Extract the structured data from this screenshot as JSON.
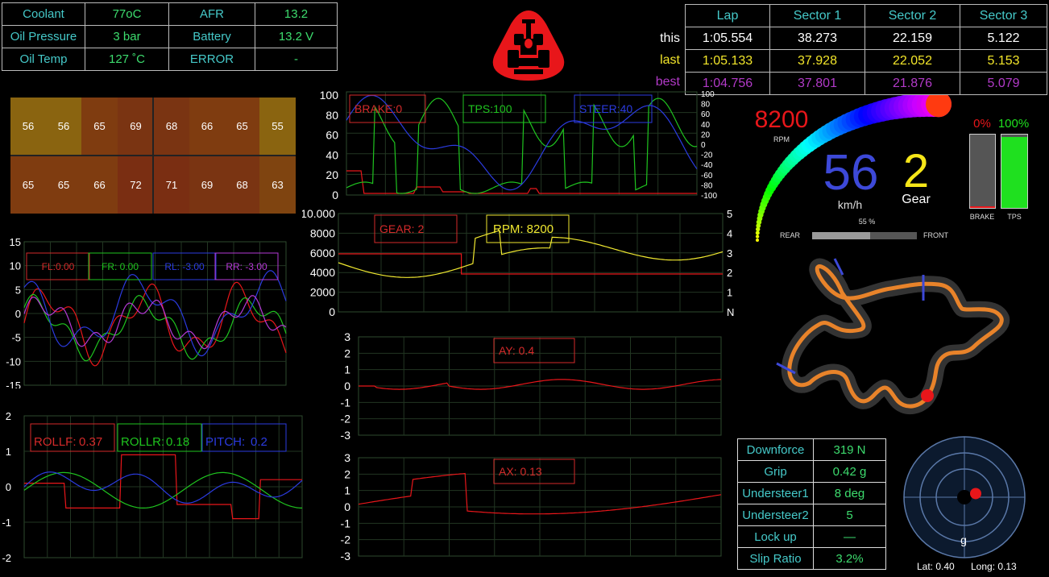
{
  "status_table": [
    {
      "k1": "Coolant",
      "v1": "77oC",
      "k2": "AFR",
      "v2": "13.2"
    },
    {
      "k1": "Oil Pressure",
      "v1": "3 bar",
      "k2": "Battery",
      "v2": "13.2 V"
    },
    {
      "k1": "Oil Temp",
      "v1": "127 ˚C",
      "k2": "ERROR",
      "v2": "-"
    }
  ],
  "lap_table": {
    "headers": [
      "Lap",
      "Sector 1",
      "Sector 2",
      "Sector 3"
    ],
    "rows": [
      {
        "name": "this",
        "color": "#ffffff",
        "values": [
          "1:05.554",
          "38.273",
          "22.159",
          "5.122"
        ]
      },
      {
        "name": "last",
        "color": "#f2e52a",
        "values": [
          "1:05.133",
          "37.928",
          "22.052",
          "5.153"
        ]
      },
      {
        "name": "best",
        "color": "#b23ac8",
        "values": [
          "1:04.756",
          "37.801",
          "21.876",
          "5.079"
        ]
      }
    ]
  },
  "tyre_temps": {
    "cells": [
      {
        "value": "56",
        "color": "#8a6410"
      },
      {
        "value": "56",
        "color": "#8a6410"
      },
      {
        "value": "65",
        "color": "#7f3c10"
      },
      {
        "value": "69",
        "color": "#7a3412"
      },
      {
        "value": "68",
        "color": "#7a3412"
      },
      {
        "value": "66",
        "color": "#7f3c10"
      },
      {
        "value": "65",
        "color": "#7f3c10"
      },
      {
        "value": "55",
        "color": "#8a6410"
      },
      {
        "value": "65",
        "color": "#7f3c10"
      },
      {
        "value": "65",
        "color": "#7f3c10"
      },
      {
        "value": "66",
        "color": "#7f3c10"
      },
      {
        "value": "72",
        "color": "#7a2e12"
      },
      {
        "value": "71",
        "color": "#7a2e12"
      },
      {
        "value": "69",
        "color": "#7a3412"
      },
      {
        "value": "68",
        "color": "#7a3412"
      },
      {
        "value": "63",
        "color": "#7f4410"
      }
    ]
  },
  "gauge": {
    "rpm_value": "8200",
    "rpm_unit": "RPM",
    "speed": "56",
    "speed_unit": "km/h",
    "gear": "2",
    "gear_label": "Gear",
    "brake_pct": "0%",
    "tps_pct": "100%",
    "brake_label": "BRAKE",
    "tps_label": "TPS",
    "brake_fill": 0.0,
    "tps_fill": 1.0,
    "balance_pct": "55 %",
    "rear_label": "REAR",
    "front_label": "FRONT",
    "balance_fill": 0.55
  },
  "stats_table": [
    {
      "k": "Downforce",
      "v": "319 N"
    },
    {
      "k": "Grip",
      "v": "0.42 g"
    },
    {
      "k": "Understeer1",
      "v": "8 deg"
    },
    {
      "k": "Understeer2",
      "v": "5"
    },
    {
      "k": "Lock up",
      "v": "—"
    },
    {
      "k": "Slip Ratio",
      "v": "3.2%"
    }
  ],
  "gg": {
    "lat_label": "Lat: 0.40",
    "long_label": "Long: 0.13",
    "unit": "g",
    "lat": 0.4,
    "long": 0.13
  },
  "charts": {
    "inputs": {
      "legend": [
        {
          "text": "BRAKE:0",
          "color": "#d42a2a"
        },
        {
          "text": "TPS:100",
          "color": "#1fc41f"
        },
        {
          "text": "STEER:40",
          "color": "#2b3be0"
        }
      ],
      "left_ticks": [
        "100",
        "80",
        "60",
        "40",
        "20",
        "0"
      ],
      "right_ticks": [
        "100",
        "80",
        "60",
        "40",
        "20",
        "0",
        "-20",
        "-40",
        "-60",
        "-80",
        "-100"
      ]
    },
    "rpm": {
      "legend": [
        {
          "text": "GEAR: 2",
          "color": "#d42a2a"
        },
        {
          "text": "RPM: 8200",
          "color": "#f0e830"
        }
      ],
      "left_ticks": [
        "10.000",
        "8000",
        "6000",
        "4000",
        "2000",
        "0"
      ],
      "right_ticks": [
        "5",
        "4",
        "3",
        "2",
        "1",
        "N"
      ]
    },
    "ay": {
      "legend": [
        {
          "text": "AY: 0.4",
          "color": "#d42a2a"
        }
      ],
      "ticks": [
        "3",
        "2",
        "1",
        "0",
        "-1",
        "-2",
        "-3"
      ]
    },
    "ax": {
      "legend": [
        {
          "text": "AX: 0.13",
          "color": "#d42a2a"
        }
      ],
      "ticks": [
        "3",
        "2",
        "1",
        "0",
        "-1",
        "-2",
        "-3"
      ]
    },
    "susp": {
      "legend": [
        {
          "text": "FL:0.00",
          "color": "#d42a2a"
        },
        {
          "text": "FR: 0.00",
          "color": "#1fc41f"
        },
        {
          "text": "RL: -3.00",
          "color": "#2b3be0"
        },
        {
          "text": "RR: -3.00",
          "color": "#b53ad6"
        }
      ],
      "ticks": [
        "15",
        "10",
        "5",
        "0",
        "-5",
        "-10",
        "-15"
      ]
    },
    "roll": {
      "legend": [
        {
          "label": "ROLLF:",
          "value": "0.37",
          "color": "#d42a2a"
        },
        {
          "label": "ROLLR:",
          "value": "0.18",
          "color": "#1fc41f"
        },
        {
          "label": "PITCH:",
          "value": "0.2",
          "color": "#2b3be0"
        }
      ],
      "ticks": [
        "2",
        "1",
        "0",
        "-1",
        "-2"
      ]
    }
  }
}
